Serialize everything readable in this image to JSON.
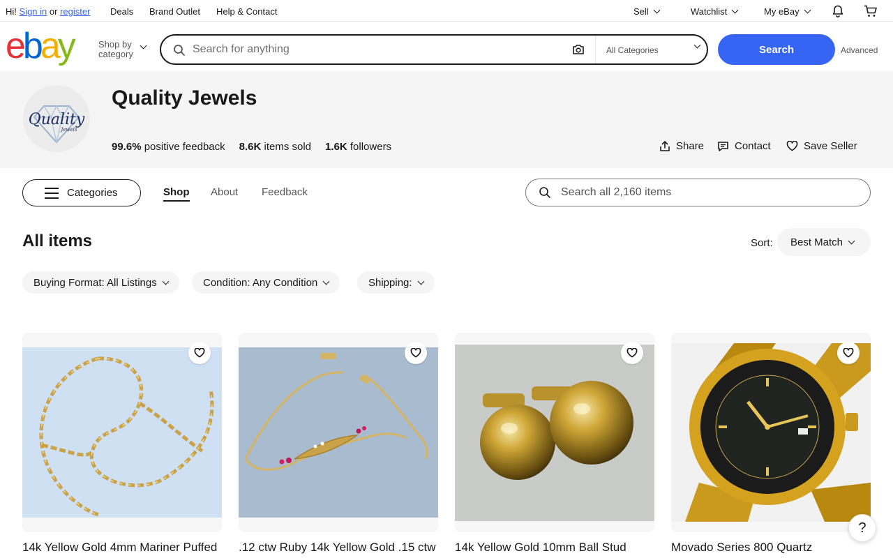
{
  "topbar": {
    "greeting": "Hi!",
    "signin": "Sign in",
    "or": "or",
    "register": "register",
    "deals": "Deals",
    "brand_outlet": "Brand Outlet",
    "help": "Help & Contact",
    "sell": "Sell",
    "watchlist": "Watchlist",
    "myebay": "My eBay"
  },
  "header": {
    "logo": [
      "e",
      "b",
      "a",
      "y"
    ],
    "shop_by_1": "Shop by",
    "shop_by_2": "category",
    "search_placeholder": "Search for anything",
    "category": "All Categories",
    "search_button": "Search",
    "advanced": "Advanced"
  },
  "seller": {
    "name": "Quality Jewels",
    "logo_text": "Quality",
    "logo_sub": "Jewels",
    "feedback_value": "99.6%",
    "feedback_label": "positive feedback",
    "sold_value": "8.6K",
    "sold_label": "items sold",
    "followers_value": "1.6K",
    "followers_label": "followers",
    "share": "Share",
    "contact": "Contact",
    "save": "Save Seller"
  },
  "shopnav": {
    "categories": "Categories",
    "tabs": [
      "Shop",
      "About",
      "Feedback"
    ],
    "search_placeholder": "Search all 2,160 items"
  },
  "listing": {
    "title": "All items",
    "sort_label": "Sort:",
    "sort_value": "Best Match",
    "filters": [
      "Buying Format: All Listings",
      "Condition: Any Condition",
      "Shipping:"
    ]
  },
  "items": [
    {
      "title": "14k Yellow Gold 4mm Mariner Puffed"
    },
    {
      "title": ".12 ctw Ruby 14k Yellow Gold .15 ctw"
    },
    {
      "title": "14k Yellow Gold 10mm Ball Stud"
    },
    {
      "title": "Movado Series 800 Quartz"
    }
  ],
  "help": "?"
}
